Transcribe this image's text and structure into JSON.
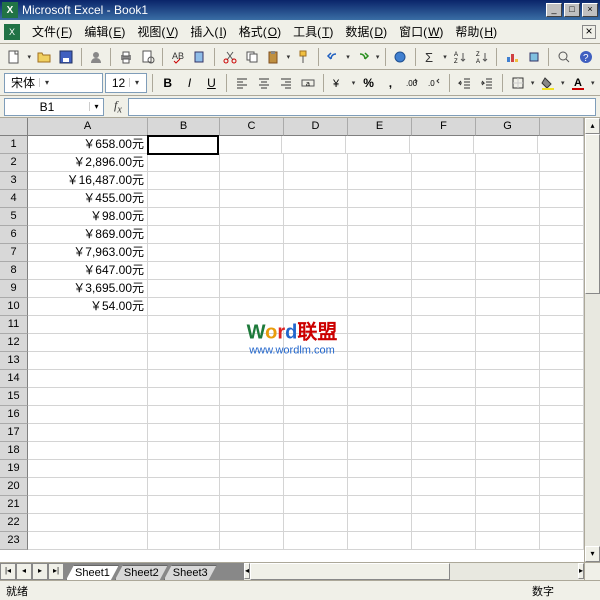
{
  "window": {
    "title": "Microsoft Excel - Book1"
  },
  "menus": [
    {
      "label": "文件",
      "key": "F"
    },
    {
      "label": "编辑",
      "key": "E"
    },
    {
      "label": "视图",
      "key": "V"
    },
    {
      "label": "插入",
      "key": "I"
    },
    {
      "label": "格式",
      "key": "O"
    },
    {
      "label": "工具",
      "key": "T"
    },
    {
      "label": "数据",
      "key": "D"
    },
    {
      "label": "窗口",
      "key": "W"
    },
    {
      "label": "帮助",
      "key": "H"
    }
  ],
  "font": {
    "name": "宋体",
    "size": "12"
  },
  "namebox": "B1",
  "formula": "",
  "columns": [
    "A",
    "B",
    "C",
    "D",
    "E",
    "F",
    "G"
  ],
  "rows_visible": 23,
  "active_cell": {
    "row": 1,
    "col": "B"
  },
  "data_A": [
    "￥658.00元",
    "￥2,896.00元",
    "￥16,487.00元",
    "￥455.00元",
    "￥98.00元",
    "￥869.00元",
    "￥7,963.00元",
    "￥647.00元",
    "￥3,695.00元",
    "￥54.00元"
  ],
  "sheets": [
    "Sheet1",
    "Sheet2",
    "Sheet3"
  ],
  "active_sheet": 0,
  "status": {
    "left": "就绪",
    "right": "数字"
  },
  "watermark": {
    "brand_chars": [
      "W",
      "o",
      "r",
      "d"
    ],
    "brand_suffix": "联盟",
    "url": "www.wordlm.com"
  }
}
